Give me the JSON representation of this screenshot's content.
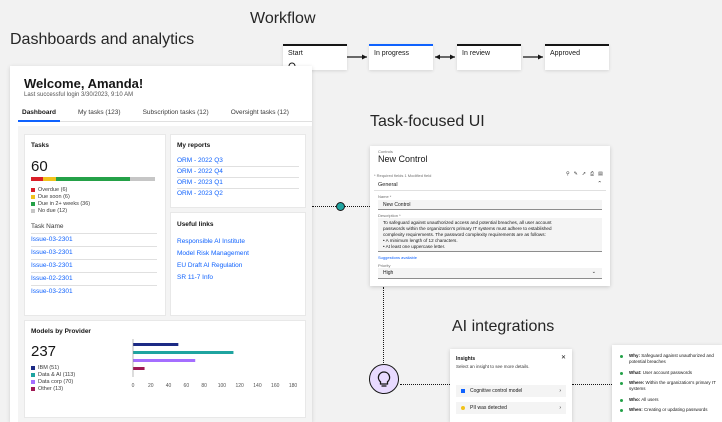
{
  "sections": {
    "workflow": "Workflow",
    "dashboards": "Dashboards and analytics",
    "task_focused": "Task-focused UI",
    "ai_integrations": "AI integrations"
  },
  "workflow": {
    "steps": [
      "Start",
      "In progress",
      "In review",
      "Approved"
    ]
  },
  "dashboard": {
    "welcome": "Welcome, Amanda!",
    "last_login": "Last successful login 3/30/2023, 9:10 AM",
    "tabs": [
      "Dashboard",
      "My tasks (123)",
      "Subscription tasks (12)",
      "Oversight tasks (12)"
    ],
    "tasks": {
      "title": "Tasks",
      "total": "60",
      "legend": [
        {
          "label": "Overdue (6)",
          "color": "#da1e28"
        },
        {
          "label": "Due soon (6)",
          "color": "#f1c21b"
        },
        {
          "label": "Due in 2+ weeks (36)",
          "color": "#24a148"
        },
        {
          "label": "No due (12)",
          "color": "#c6c6c6"
        }
      ],
      "bar": [
        6,
        6,
        36,
        12
      ],
      "task_name_header": "Task Name",
      "task_links": [
        "Issue-03-2301",
        "Issue-03-2301",
        "Issue-03-2301",
        "Issue-02-2301",
        "Issue-03-2301"
      ]
    },
    "reports": {
      "title": "My reports",
      "links": [
        "ORM - 2022 Q3",
        "ORM - 2022 Q4",
        "ORM - 2023 Q1",
        "ORM - 2023 Q2"
      ]
    },
    "useful_links": {
      "title": "Useful links",
      "links": [
        "Responsible AI Institute",
        "Model Risk Management",
        "EU Draft AI Regulation",
        "SR 11-7 Info"
      ]
    },
    "models": {
      "title": "Models by Provider",
      "total": "237",
      "legend": [
        {
          "label": "IBM (51)",
          "color": "#1c2a85"
        },
        {
          "label": "Data & AI (113)",
          "color": "#1fa4a0"
        },
        {
          "label": "Data corp (70)",
          "color": "#a56eff"
        },
        {
          "label": "Other (13)",
          "color": "#9f1853"
        }
      ],
      "values": [
        51,
        113,
        70,
        13
      ],
      "axis_ticks": [
        "0",
        "20",
        "40",
        "60",
        "80",
        "100",
        "120",
        "140",
        "160",
        "180"
      ]
    }
  },
  "task_ui": {
    "breadcrumb": "Controls",
    "title": "New Control",
    "required_note": "* Required fields  1 Modified field",
    "section": "General",
    "name_label": "Name *",
    "name_value": "New Control",
    "desc_label": "Description *",
    "desc_lines": [
      "To safeguard against unauthorized access and potential breaches, all user account",
      "passwords within the organization's primary IT systems must adhere to established",
      "complexity requirements. The password complexity requirements are as follows:",
      "•  A minimum length of 12 characters.",
      "•  At least one uppercase letter."
    ],
    "suggestion_link": "Suggestions available",
    "priority_label": "Priority",
    "priority_value": "High"
  },
  "insights": {
    "title": "Insights",
    "subtitle": "Select an insight to see more details.",
    "items": [
      {
        "label": "Cognitive control model",
        "color": "#0f62fe"
      },
      {
        "label": "PII was detected",
        "color": "#f1c21b"
      }
    ]
  },
  "ai_details": [
    {
      "key": "Why:",
      "text": "Safeguard against unauthorized and potential breaches"
    },
    {
      "key": "What:",
      "text": "User account passwords"
    },
    {
      "key": "Where:",
      "text": "Within the organization's primary IT systems"
    },
    {
      "key": "Who:",
      "text": "All users"
    },
    {
      "key": "When:",
      "text": "Creating or updating passwords"
    }
  ]
}
